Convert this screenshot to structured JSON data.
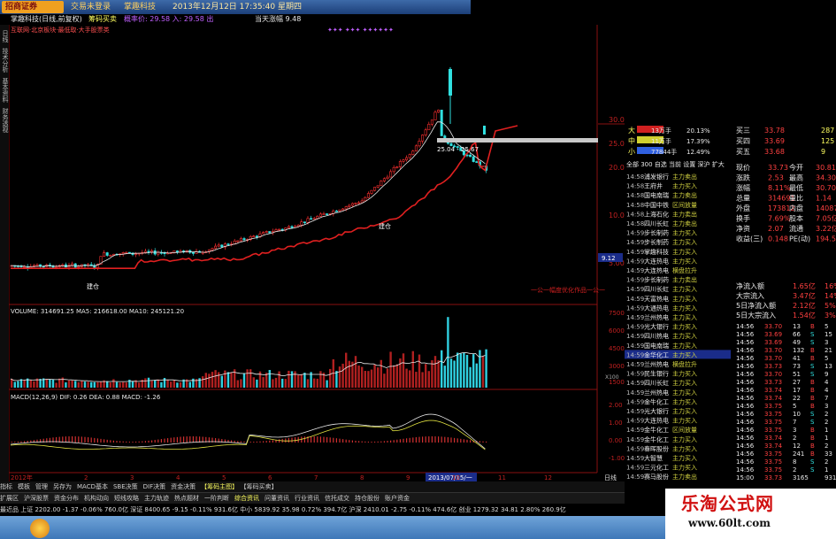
{
  "window": {
    "logo_text": "招商证券",
    "menu_trade": "交易未登录",
    "stock_menu": "掌趣科技",
    "datetime": "2013年12月12日 17:35:40 星期四"
  },
  "stockbar": {
    "name": "掌趣科技(日线,前复权)",
    "indicator": "筹码买卖",
    "pane_label": "概率价: 29.58 入: 29.58 出",
    "top_note": "当天涨幅 9.48",
    "concept_line": "互联网·北京板块·最低取·大手股票类"
  },
  "left_rail": [
    "日线",
    "技术分析",
    "基本资料",
    "财务透视"
  ],
  "main_chart": {
    "y_ticks": [
      "30.00",
      "25.00",
      "20.00",
      "15.00",
      "10.00",
      "5.00"
    ],
    "annotation_range": "25.04 - 25.67",
    "label_buy1": "建仓",
    "label_buy2": "建仓",
    "corner_label": "一公一幅度优化作品一公一",
    "price_tag": "9.12"
  },
  "volume_pane": {
    "header": "VOLUME: 314691.25  MA5: 216618.00  MA10: 245121.20",
    "y_ticks": [
      "75000",
      "60000",
      "45000",
      "30000",
      "15000"
    ],
    "unit_label": "X100"
  },
  "macd_pane": {
    "header": "MACD(12,26,9)  DIF: 0.26  DEA: 0.88  MACD: -1.26",
    "y_ticks": [
      "2.00",
      "1.00",
      "0.00",
      "-1.00"
    ]
  },
  "x_axis": {
    "year_label": "2012年",
    "date_box": "2013/07/15/一",
    "ticks": [
      "2",
      "3",
      "4",
      "5",
      "6",
      "7",
      "8",
      "9",
      "10",
      "11",
      "12"
    ],
    "period": "日线"
  },
  "right_panel": {
    "bigorder_rows": [
      {
        "tag": "大",
        "vol": "13万手",
        "pct": "20.13%"
      },
      {
        "tag": "中",
        "vol": "11万手",
        "pct": "17.39%"
      },
      {
        "tag": "小",
        "vol": "77844手",
        "pct": "12.49%"
      }
    ],
    "ask_rows": [
      {
        "label": "买三",
        "price": "33.78",
        "vol": "287"
      },
      {
        "label": "买四",
        "price": "33.69",
        "vol": "125"
      },
      {
        "label": "买五",
        "price": "33.68",
        "vol": "9"
      }
    ],
    "tabs": "全部 300 自选 当前 设置 深沪 扩大",
    "quote": [
      {
        "k1": "现价",
        "v1": "33.73",
        "k2": "今开",
        "v2": "30.81"
      },
      {
        "k1": "涨跌",
        "v1": "2.53",
        "k2": "最高",
        "v2": "34.30"
      },
      {
        "k1": "涨幅",
        "v1": "8.11%",
        "k2": "最低",
        "v2": "30.70"
      },
      {
        "k1": "总量",
        "v1": "314691",
        "k2": "量比",
        "v2": "1.14"
      },
      {
        "k1": "外盘",
        "v1": "173812",
        "k2": "内盘",
        "v2": "140879"
      },
      {
        "k1": "换手",
        "v1": "7.69%",
        "k2": "股本",
        "v2": "7.05亿"
      },
      {
        "k1": "净资",
        "v1": "2.07",
        "k2": "流通",
        "v2": "3.22亿"
      },
      {
        "k1": "收益(三)",
        "v1": "0.148",
        "k2": "PE(动)",
        "v2": "194.5"
      }
    ],
    "flow": [
      {
        "k": "净流入额",
        "v": "1.65亿",
        "p": "16%"
      },
      {
        "k": "大宗流入",
        "v": "3.47亿",
        "p": "14%"
      },
      {
        "k": "5日净流入额",
        "v": "2.12亿",
        "p": "5%"
      },
      {
        "k": "5日大宗流入",
        "v": "1.54亿",
        "p": "3%"
      }
    ],
    "news_rows": [
      {
        "t": "14:58",
        "n": "浦发银行",
        "a": "主力卖出"
      },
      {
        "t": "14:58",
        "n": "王府井",
        "a": "主力买入"
      },
      {
        "t": "14:58",
        "n": "国电南瑞",
        "a": "主力卖出"
      },
      {
        "t": "14:58",
        "n": "中国中铁",
        "a": "区间放量"
      },
      {
        "t": "14:58",
        "n": "上海石化",
        "a": "主力卖出"
      },
      {
        "t": "14:58",
        "n": "四川长虹",
        "a": "主力卖出"
      },
      {
        "t": "14:59",
        "n": "步长制药",
        "a": "主力买入"
      },
      {
        "t": "14:59",
        "n": "步长制药",
        "a": "主力买入"
      },
      {
        "t": "14:59",
        "n": "掌趣科技",
        "a": "主力买入"
      },
      {
        "t": "14:59",
        "n": "大连热电",
        "a": "主力买入"
      },
      {
        "t": "14:59",
        "n": "大连热电",
        "a": "横盘拉升"
      },
      {
        "t": "14:59",
        "n": "步长制药",
        "a": "主力卖出"
      },
      {
        "t": "14:59",
        "n": "四川长虹",
        "a": "主力买入"
      },
      {
        "t": "14:59",
        "n": "天富热电",
        "a": "主力买入"
      },
      {
        "t": "14:59",
        "n": "大通热电",
        "a": "主力买入"
      },
      {
        "t": "14:59",
        "n": "兰州热电",
        "a": "主力买入"
      },
      {
        "t": "14:59",
        "n": "光大银行",
        "a": "主力买入"
      },
      {
        "t": "14:59",
        "n": "四川热电",
        "a": "主力买入"
      },
      {
        "t": "14:59",
        "n": "国电南瑞",
        "a": "主力买入"
      },
      {
        "t": "14:59",
        "n": "金华化工",
        "a": "主力买入"
      },
      {
        "t": "14:59",
        "n": "兰州热电",
        "a": "横盘拉升"
      },
      {
        "t": "14:59",
        "n": "民生银行",
        "a": "主力买入"
      },
      {
        "t": "14:59",
        "n": "四川长虹",
        "a": "主力买入"
      },
      {
        "t": "14:59",
        "n": "兰州热电",
        "a": "主力买入"
      },
      {
        "t": "14:59",
        "n": "金牛化工",
        "a": "主力买入"
      },
      {
        "t": "14:59",
        "n": "光大银行",
        "a": "主力买入"
      },
      {
        "t": "14:59",
        "n": "大连热电",
        "a": "主力买入"
      },
      {
        "t": "14:59",
        "n": "金牛化工",
        "a": "区间放量"
      },
      {
        "t": "14:59",
        "n": "金牛化工",
        "a": "主力买入"
      },
      {
        "t": "14:59",
        "n": "春晖股份",
        "a": "主力买入"
      },
      {
        "t": "14:59",
        "n": "大智慧",
        "a": "主力买入"
      },
      {
        "t": "14:59",
        "n": "三元化工",
        "a": "主力买入"
      },
      {
        "t": "14:59",
        "n": "赛马股份",
        "a": "主力卖出"
      }
    ],
    "ticks": [
      {
        "t": "14:56",
        "p": "33.70",
        "v": "13",
        "d": "B",
        "n": "5"
      },
      {
        "t": "14:56",
        "p": "33.69",
        "v": "66",
        "d": "S",
        "n": "15"
      },
      {
        "t": "14:56",
        "p": "33.69",
        "v": "49",
        "d": "S",
        "n": "3"
      },
      {
        "t": "14:56",
        "p": "33.70",
        "v": "132",
        "d": "B",
        "n": "21"
      },
      {
        "t": "14:56",
        "p": "33.70",
        "v": "41",
        "d": "B",
        "n": "5"
      },
      {
        "t": "14:56",
        "p": "33.73",
        "v": "73",
        "d": "S",
        "n": "13"
      },
      {
        "t": "14:56",
        "p": "33.70",
        "v": "51",
        "d": "S",
        "n": "9"
      },
      {
        "t": "14:56",
        "p": "33.73",
        "v": "27",
        "d": "B",
        "n": "4"
      },
      {
        "t": "14:56",
        "p": "33.74",
        "v": "17",
        "d": "B",
        "n": "4"
      },
      {
        "t": "14:56",
        "p": "33.74",
        "v": "22",
        "d": "B",
        "n": "7"
      },
      {
        "t": "14:56",
        "p": "33.75",
        "v": "5",
        "d": "B",
        "n": "3"
      },
      {
        "t": "14:56",
        "p": "33.75",
        "v": "10",
        "d": "S",
        "n": "2"
      },
      {
        "t": "14:56",
        "p": "33.75",
        "v": "7",
        "d": "S",
        "n": "2"
      },
      {
        "t": "14:56",
        "p": "33.75",
        "v": "3",
        "d": "B",
        "n": "1"
      },
      {
        "t": "14:56",
        "p": "33.74",
        "v": "2",
        "d": "B",
        "n": "1"
      },
      {
        "t": "14:56",
        "p": "33.74",
        "v": "12",
        "d": "B",
        "n": "2"
      },
      {
        "t": "14:56",
        "p": "33.75",
        "v": "241",
        "d": "B",
        "n": "33"
      },
      {
        "t": "14:56",
        "p": "33.75",
        "v": "8",
        "d": "S",
        "n": "2"
      },
      {
        "t": "14:56",
        "p": "33.75",
        "v": "2",
        "d": "S",
        "n": "1"
      },
      {
        "t": "15:00",
        "p": "33.73",
        "v": "3165",
        "d": "",
        "n": "931"
      }
    ]
  },
  "bottom_tabs": {
    "row1": [
      "指标",
      "模板",
      "管理",
      "另存为",
      "MACD基本",
      "SBE决策",
      "DIF决策",
      "资金决策",
      "【筹码主图】",
      "【筹码买卖】"
    ],
    "row2": [
      "扩展区",
      "沪深股票",
      "资金分布",
      "机构动向",
      "短线攻略",
      "主力轨迹",
      "热点题材",
      "一阶判断",
      "综合资讯",
      "问董资讯",
      "行业资讯",
      "信托成交",
      "持仓股份",
      "账户资金"
    ]
  },
  "ticker": {
    "text": "最近品 上证 2202.00 -1.37 -0.06% 760.0亿 深证 8400.65 -9.15 -0.11% 931.6亿 中小 5839.92 35.98 0.72% 394.7亿 沪深 2410.01 -2.75 -0.11% 474.6亿 创业 1279.32 34.81 2.80% 260.9亿"
  },
  "watermark": {
    "title": "乐淘公式网",
    "url": "www.60lt.com"
  },
  "colors": {
    "up": "#ff3030",
    "down": "#30e0e0",
    "ma_red": "#e02020",
    "accent_yellow": "#ffff40"
  }
}
